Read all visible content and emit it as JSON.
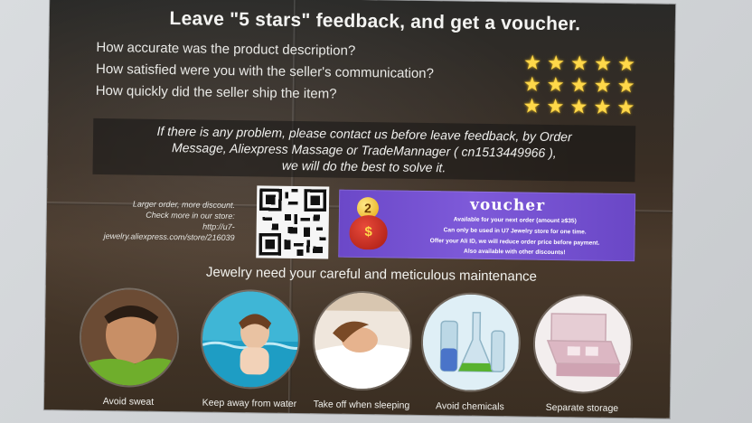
{
  "flyer": {
    "headline": "Leave \"5 stars\" feedback, and get a voucher.",
    "questions": [
      "How accurate was the product description?",
      "How satisfied were you with the seller's communication?",
      "How quickly did the seller ship the item?"
    ],
    "stars_per_row": 5,
    "notice": [
      "If there is any problem, please contact us before leave feedback, by Order",
      "Message, Aliexpress Massage or TradeMannager ( cn1513449966 ),",
      "we will do the best to solve it."
    ],
    "store_info": [
      "Larger order, more discount.",
      "Check more in our store:",
      "http://u7-jewelry.aliexpress.com/store/216039"
    ],
    "voucher": {
      "coin_value": "2",
      "bag_symbol": "$",
      "title": "voucher",
      "lines": [
        "Available for your next order (amount ≥$35)",
        "Can only be used in U7 Jewelry store for one time.",
        "Offer your Ali ID, we will reduce order price before payment.",
        "Also available with other discounts!"
      ]
    },
    "care_title": "Jewelry need your careful and meticulous maintenance",
    "care_tips": [
      {
        "label": "Avoid sweat",
        "icon": "sweat-icon"
      },
      {
        "label": "Keep away from water",
        "icon": "water-icon"
      },
      {
        "label": "Take off when sleeping",
        "icon": "sleeping-icon"
      },
      {
        "label": "Avoid chemicals",
        "icon": "chemicals-icon"
      },
      {
        "label": "Separate storage",
        "icon": "storage-box-icon"
      }
    ],
    "colors": {
      "star": "#ffd84a",
      "voucher_bg": "#7e5ad9",
      "paper_dark": "#3a2e24"
    }
  }
}
